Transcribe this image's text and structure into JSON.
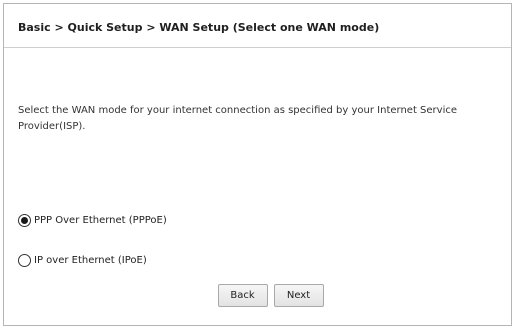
{
  "breadcrumb": "Basic > Quick Setup > WAN Setup (Select one WAN mode)",
  "description": "Select the WAN mode for your internet connection as specified by your Internet Service Provider(ISP).",
  "wan_modes": [
    {
      "label": "PPP Over Ethernet (PPPoE)",
      "selected": true
    },
    {
      "label": "IP over Ethernet (IPoE)",
      "selected": false
    }
  ],
  "buttons": {
    "back": "Back",
    "next": "Next"
  }
}
